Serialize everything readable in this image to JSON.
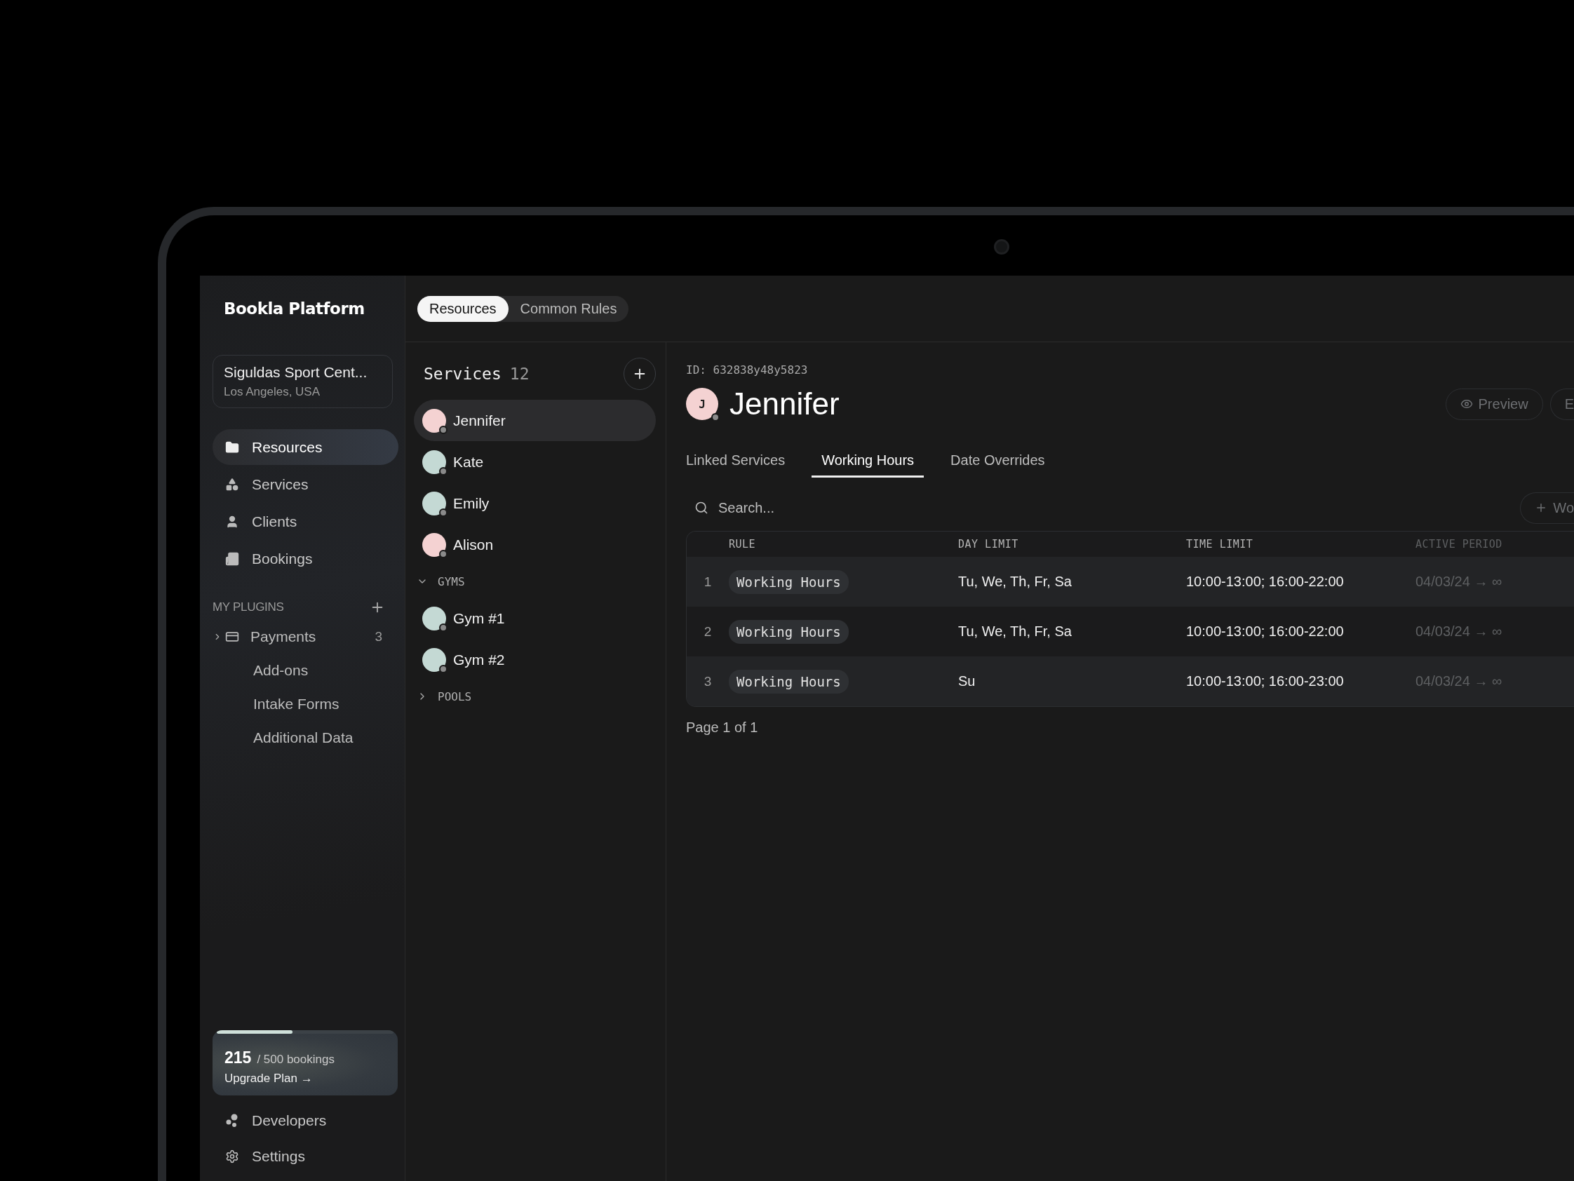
{
  "brand": "Bookla Platform",
  "workspace": {
    "name": "Siguldas Sport Cent...",
    "location": "Los Angeles, USA"
  },
  "nav": [
    {
      "label": "Resources",
      "selected": true
    },
    {
      "label": "Services",
      "selected": false
    },
    {
      "label": "Clients",
      "selected": false
    },
    {
      "label": "Bookings",
      "selected": false
    }
  ],
  "plugins": {
    "title": "MY PLUGINS",
    "items": [
      {
        "kind": "plugin",
        "label": "Payments",
        "count": "3",
        "expanded": false
      },
      {
        "kind": "sub",
        "label": "Add-ons"
      },
      {
        "kind": "sub",
        "label": "Intake Forms"
      },
      {
        "kind": "sub",
        "label": "Additional Data"
      }
    ]
  },
  "usage": {
    "used": "215",
    "total": "/ 500 bookings",
    "link": "Upgrade Plan →",
    "level": 0.43
  },
  "footer_nav": [
    {
      "label": "Developers"
    },
    {
      "label": "Settings"
    }
  ],
  "top_tabs": [
    {
      "label": "Resources",
      "selected": true
    },
    {
      "label": "Common Rules",
      "selected": false
    }
  ],
  "resources": {
    "title": "Services",
    "count": "12",
    "items": [
      {
        "kind": "person",
        "name": "Jennifer",
        "selected": true,
        "color": "#f4d2d2"
      },
      {
        "kind": "person",
        "name": "Kate",
        "selected": false,
        "color": "#c4d9d4"
      },
      {
        "kind": "person",
        "name": "Emily",
        "selected": false,
        "color": "#c4d9d4"
      },
      {
        "kind": "person",
        "name": "Alison",
        "selected": false,
        "color": "#f4d2d2"
      },
      {
        "kind": "group",
        "name": "GYMS",
        "expanded": true,
        "children": [
          {
            "kind": "person",
            "name": "Gym #1",
            "selected": false,
            "color": "#c4d9d4"
          },
          {
            "kind": "person",
            "name": "Gym #2",
            "selected": false,
            "color": "#c4d9d4"
          }
        ]
      },
      {
        "kind": "group",
        "name": "POOLS",
        "expanded": false
      }
    ]
  },
  "detail": {
    "id": "ID: 632838y48y5823",
    "initial": "J",
    "name": "Jennifer",
    "actions": [
      "Preview",
      "E"
    ],
    "tabs": [
      {
        "label": "Linked Services",
        "selected": false
      },
      {
        "label": "Working Hours",
        "selected": true
      },
      {
        "label": "Date Overrides",
        "selected": false
      }
    ],
    "search": {
      "placeholder": "Search..."
    },
    "add_button": "Wo",
    "table": {
      "columns": [
        "RULE",
        "DAY LIMIT",
        "TIME LIMIT",
        "ACTIVE PERIOD"
      ],
      "rows": [
        {
          "index": "1",
          "rule": "Working Hours",
          "day_limit": "Tu, We, Th, Fr, Sa",
          "time_limit": "10:00-13:00; 16:00-22:00",
          "active_period": "04/03/24 → ∞"
        },
        {
          "index": "2",
          "rule": "Working Hours",
          "day_limit": "Tu, We, Th, Fr, Sa",
          "time_limit": "10:00-13:00; 16:00-22:00",
          "active_period": "04/03/24 → ∞"
        },
        {
          "index": "3",
          "rule": "Working Hours",
          "day_limit": "Su",
          "time_limit": "10:00-13:00; 16:00-23:00",
          "active_period": "04/03/24 → ∞"
        }
      ]
    },
    "pagination": "Page 1 of 1"
  }
}
